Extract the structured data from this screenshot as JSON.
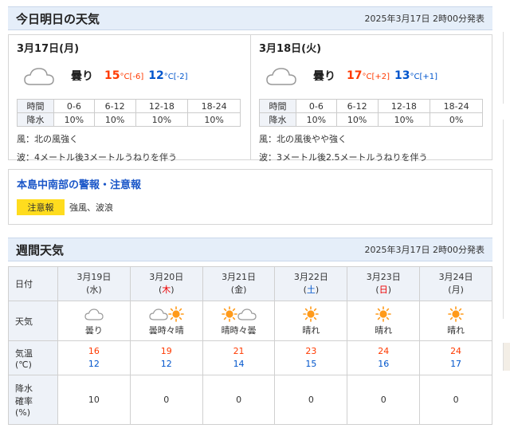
{
  "today_tomorrow": {
    "title": "今日明日の天気",
    "issued": "2025年3月17日 2時00分発表",
    "days": [
      {
        "date": "3月17日(月)",
        "weather": "曇り",
        "icon": "cloud-icon",
        "high": "15",
        "high_diff": "[-6]",
        "low": "12",
        "low_diff": "[-2]",
        "unit": "°C",
        "rain_header": [
          "時間",
          "0-6",
          "6-12",
          "12-18",
          "18-24"
        ],
        "rain_values": [
          "降水",
          "10%",
          "10%",
          "10%",
          "10%"
        ],
        "wind": "風：北の風強く",
        "wave": "波：4メートル後3メートルうねりを伴う"
      },
      {
        "date": "3月18日(火)",
        "weather": "曇り",
        "icon": "cloud-icon",
        "high": "17",
        "high_diff": "[+2]",
        "low": "13",
        "low_diff": "[+1]",
        "unit": "°C",
        "rain_header": [
          "時間",
          "0-6",
          "6-12",
          "12-18",
          "18-24"
        ],
        "rain_values": [
          "降水",
          "10%",
          "10%",
          "10%",
          "0%"
        ],
        "wind": "風：北の風後やや強く",
        "wave": "波：3メートル後2.5メートルうねりを伴う"
      }
    ]
  },
  "warning": {
    "title": "本島中南部の警報・注意報",
    "badge": "注意報",
    "text": "強風、波浪"
  },
  "weekly": {
    "title": "週間天気",
    "issued": "2025年3月17日 2時00分発表",
    "row_labels": {
      "date": "日付",
      "weather": "天気",
      "temp_l1": "気温",
      "temp_l2": "(℃)",
      "rain_l1": "降水",
      "rain_l2": "確率",
      "rain_l3": "(%)"
    },
    "days": [
      {
        "date": "3月19日",
        "dow_pre": "(",
        "dow": "水",
        "dow_post": ")",
        "dow_type": "weekday",
        "icons": [
          "cloud-icon"
        ],
        "weather": "曇り",
        "high": "16",
        "low": "12",
        "rain": "10"
      },
      {
        "date": "3月20日",
        "dow_pre": "(",
        "dow": "木",
        "dow_post": ")",
        "dow_type": "holiday",
        "icons": [
          "cloud-icon",
          "sun-icon"
        ],
        "weather": "曇時々晴",
        "high": "19",
        "low": "12",
        "rain": "0"
      },
      {
        "date": "3月21日",
        "dow_pre": "(",
        "dow": "金",
        "dow_post": ")",
        "dow_type": "weekday",
        "icons": [
          "sun-icon",
          "cloud-icon"
        ],
        "weather": "晴時々曇",
        "high": "21",
        "low": "14",
        "rain": "0"
      },
      {
        "date": "3月22日",
        "dow_pre": "(",
        "dow": "土",
        "dow_post": ")",
        "dow_type": "saturday",
        "icons": [
          "sun-icon"
        ],
        "weather": "晴れ",
        "high": "23",
        "low": "15",
        "rain": "0"
      },
      {
        "date": "3月23日",
        "dow_pre": "(",
        "dow": "日",
        "dow_post": ")",
        "dow_type": "sunday",
        "icons": [
          "sun-icon"
        ],
        "weather": "晴れ",
        "high": "24",
        "low": "16",
        "rain": "0"
      },
      {
        "date": "3月24日",
        "dow_pre": "(",
        "dow": "月",
        "dow_post": ")",
        "dow_type": "weekday",
        "icons": [
          "sun-icon"
        ],
        "weather": "晴れ",
        "high": "24",
        "low": "17",
        "rain": "0"
      }
    ]
  },
  "colors": {
    "high_temp": "#ff3a00",
    "low_temp": "#0055cc",
    "header_bg": "#e5eef9",
    "warning_badge": "#ffdc1e",
    "sun": "#ff9a1a"
  }
}
